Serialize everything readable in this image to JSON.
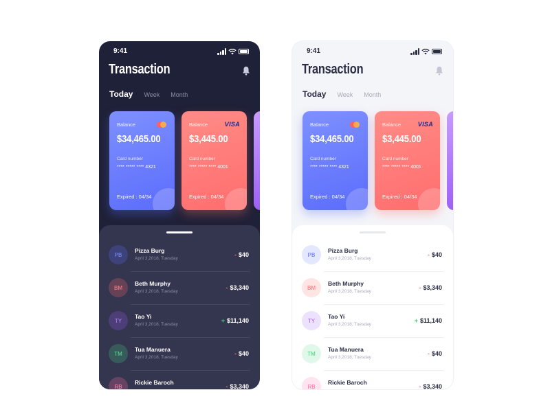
{
  "status_time": "9:41",
  "title": "Transaction",
  "tabs": [
    "Today",
    "Week",
    "Month"
  ],
  "cards": [
    {
      "balance_label": "Balance",
      "amount": "$34,465.00",
      "card_number_label": "Card number",
      "card_number": "**** ***** **** 4321",
      "expiry": "Expired : 04/34",
      "brand": "mastercard-icon"
    },
    {
      "balance_label": "Balance",
      "amount": "$3,445.00",
      "card_number_label": "Card number",
      "card_number": "**** ***** **** 4001",
      "expiry": "Expired : 04/34",
      "brand_text": "VISA"
    }
  ],
  "transactions": [
    {
      "initials": "PB",
      "name": "Pizza Burg",
      "date": "April 3,2018, Tuesday",
      "sign": "-",
      "amount": "$40"
    },
    {
      "initials": "BM",
      "name": "Beth Murphy",
      "date": "April 3,2018, Tuesday",
      "sign": "-",
      "amount": "$3,340"
    },
    {
      "initials": "TY",
      "name": "Tao Yi",
      "date": "April 3,2018, Tuesday",
      "sign": "+",
      "amount": "$11,140"
    },
    {
      "initials": "TM",
      "name": "Tua Manuera",
      "date": "April 3,2018, Tuesday",
      "sign": "-",
      "amount": "$40"
    },
    {
      "initials": "RB",
      "name": "Rickie Baroch",
      "date": "",
      "sign": "-",
      "amount": "$3,340"
    }
  ],
  "colors": {
    "dark_bg": "#1f2138",
    "dark_sheet": "#34354f",
    "light_bg": "#f4f5f9",
    "card_blue": "#6a7cfd",
    "card_coral": "#ff7b7a",
    "card_violet": "#a96cf5",
    "sign_minus": "#ff6b6b",
    "sign_plus": "#3fd07a",
    "avatar_blue": "#5b6dfb",
    "avatar_red": "#ff6d6e",
    "avatar_purple": "#9a5cf2",
    "avatar_green": "#3fd07a",
    "avatar_pink": "#ff6fa0"
  }
}
